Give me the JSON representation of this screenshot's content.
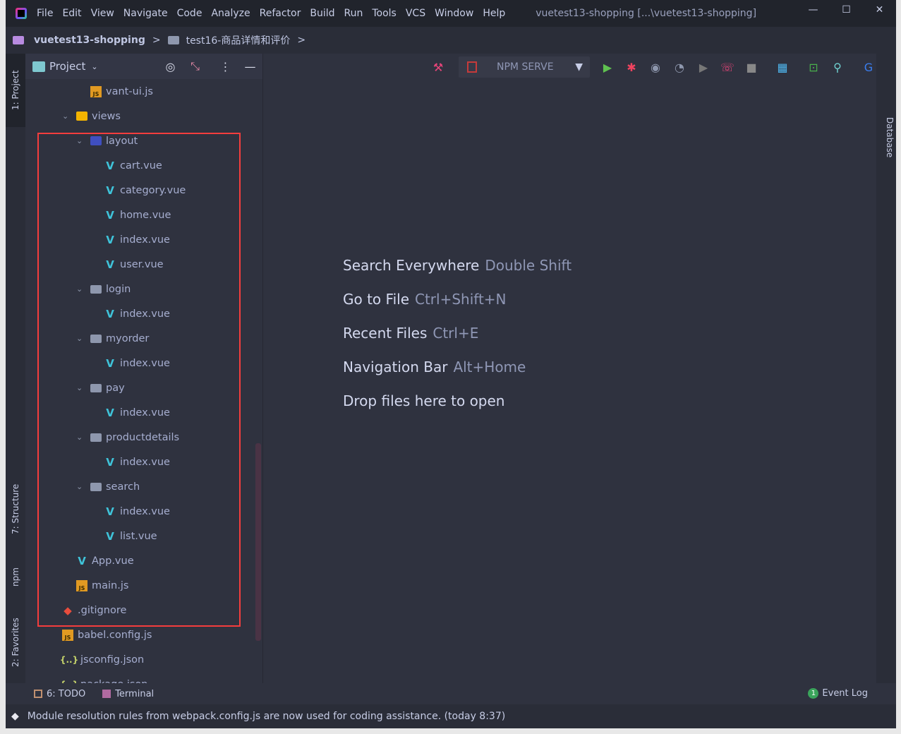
{
  "window": {
    "title": "vuetest13-shopping [...\\vuetest13-shopping]",
    "minimize": "—",
    "maximize": "☐",
    "close": "✕"
  },
  "menu": [
    "File",
    "Edit",
    "View",
    "Navigate",
    "Code",
    "Analyze",
    "Refactor",
    "Build",
    "Run",
    "Tools",
    "VCS",
    "Window",
    "Help"
  ],
  "breadcrumb": {
    "project": "vuetest13-shopping",
    "folder": "test16-商品详情和评价"
  },
  "toolbar": {
    "run_config": "NPM SERVE"
  },
  "left_tabs": {
    "project": "1: Project",
    "structure": "7: Structure",
    "npm": "npm",
    "favorites": "2: Favorites"
  },
  "right_tabs": {
    "database": "Database"
  },
  "panel": {
    "title": "Project"
  },
  "tree": [
    {
      "label": "vant-ui.js",
      "level": 2,
      "type": "js"
    },
    {
      "label": "views",
      "level": 1,
      "type": "folder-views",
      "expanded": true
    },
    {
      "label": "layout",
      "level": 2,
      "type": "folder-layout",
      "expanded": true
    },
    {
      "label": "cart.vue",
      "level": 3,
      "type": "vue"
    },
    {
      "label": "category.vue",
      "level": 3,
      "type": "vue"
    },
    {
      "label": "home.vue",
      "level": 3,
      "type": "vue"
    },
    {
      "label": "index.vue",
      "level": 3,
      "type": "vue"
    },
    {
      "label": "user.vue",
      "level": 3,
      "type": "vue"
    },
    {
      "label": "login",
      "level": 2,
      "type": "folder",
      "expanded": true
    },
    {
      "label": "index.vue",
      "level": 3,
      "type": "vue"
    },
    {
      "label": "myorder",
      "level": 2,
      "type": "folder",
      "expanded": true
    },
    {
      "label": "index.vue",
      "level": 3,
      "type": "vue"
    },
    {
      "label": "pay",
      "level": 2,
      "type": "folder",
      "expanded": true
    },
    {
      "label": "index.vue",
      "level": 3,
      "type": "vue"
    },
    {
      "label": "productdetails",
      "level": 2,
      "type": "folder",
      "expanded": true
    },
    {
      "label": "index.vue",
      "level": 3,
      "type": "vue"
    },
    {
      "label": "search",
      "level": 2,
      "type": "folder",
      "expanded": true
    },
    {
      "label": "index.vue",
      "level": 3,
      "type": "vue"
    },
    {
      "label": "list.vue",
      "level": 3,
      "type": "vue"
    },
    {
      "label": "App.vue",
      "level": 1,
      "type": "vue"
    },
    {
      "label": "main.js",
      "level": 1,
      "type": "js"
    },
    {
      "label": ".gitignore",
      "level": 0,
      "type": "git"
    },
    {
      "label": "babel.config.js",
      "level": 0,
      "type": "js"
    },
    {
      "label": "jsconfig.json",
      "level": 0,
      "type": "json"
    },
    {
      "label": "package.json",
      "level": 0,
      "type": "json"
    }
  ],
  "empty_state": [
    {
      "action": "Search Everywhere",
      "shortcut": "Double Shift"
    },
    {
      "action": "Go to File",
      "shortcut": "Ctrl+Shift+N"
    },
    {
      "action": "Recent Files",
      "shortcut": "Ctrl+E"
    },
    {
      "action": "Navigation Bar",
      "shortcut": "Alt+Home"
    },
    {
      "action": "Drop files here to open",
      "shortcut": ""
    }
  ],
  "bottom": {
    "todo": "6: TODO",
    "terminal": "Terminal",
    "event_count": "1",
    "event_log": "Event Log"
  },
  "status": {
    "message": "Module resolution rules from webpack.config.js are now used for coding assistance. (today 8:37)"
  }
}
